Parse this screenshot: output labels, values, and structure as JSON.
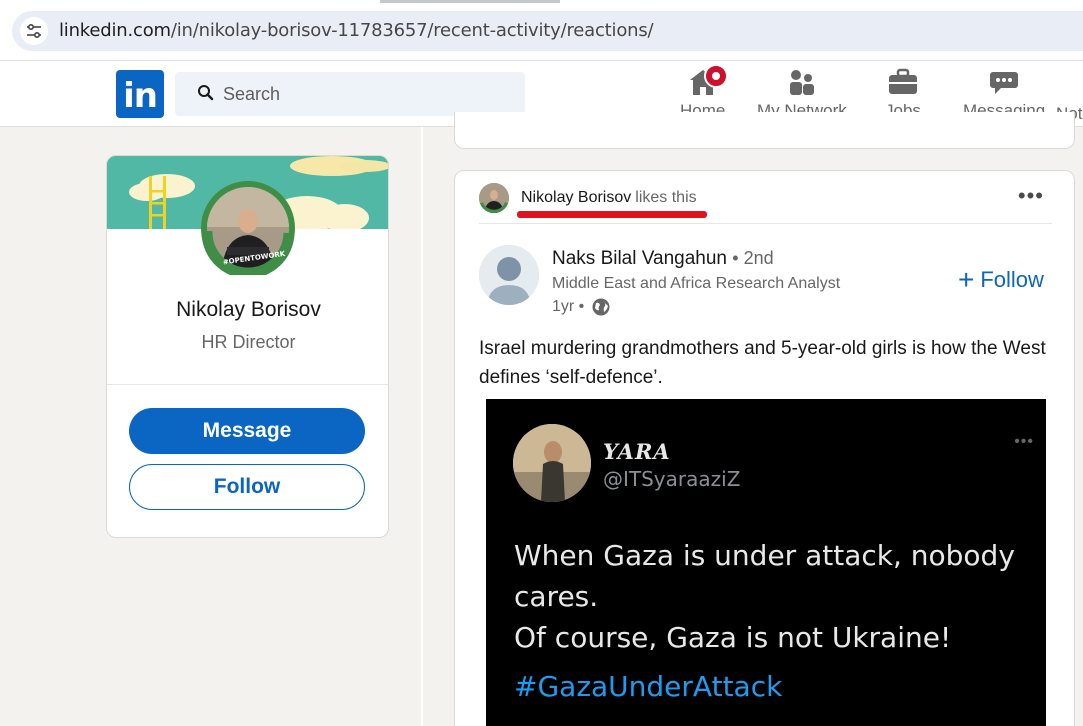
{
  "browser": {
    "url_host": "linkedin.com",
    "url_path": "/in/nikolay-borisov-11783657/recent-activity/reactions/",
    "site_info_icon": "tune-icon"
  },
  "nav": {
    "logo_text": "in",
    "search_placeholder": "Search",
    "items": [
      {
        "label": "Home",
        "icon": "home-icon"
      },
      {
        "label": "My Network",
        "icon": "people-icon"
      },
      {
        "label": "Jobs",
        "icon": "briefcase-icon"
      },
      {
        "label": "Messaging",
        "icon": "chat-icon"
      },
      {
        "label": "Not",
        "icon": "bell-icon"
      }
    ],
    "brand_color": "#0a66c2",
    "badge_color": "#cb112d"
  },
  "profile": {
    "name": "Nikolay Borisov",
    "headline": "HR Director",
    "frame_text": "#OPENTOWORK",
    "message_label": "Message",
    "follow_label": "Follow"
  },
  "post": {
    "context_name": "Nikolay Borisov",
    "context_action": "likes this",
    "author_name": "Naks Bilal Vangahun",
    "author_degree": "• 2nd",
    "author_title": "Middle East and Africa Research Analyst",
    "time": "1yr •",
    "follow_label": "Follow",
    "text": "Israel murdering grandmothers and 5-year-old girls is how the West defines ‘self-defence’.",
    "embed": {
      "name": "YARA",
      "handle": "@ITSyaraaziZ",
      "line1": "When Gaza is under attack, nobody cares.",
      "line2": "Of course, Gaza is not Ukraine!",
      "hashtag": "#GazaUnderAttack",
      "hashtag_color": "#1d9bf0"
    }
  }
}
